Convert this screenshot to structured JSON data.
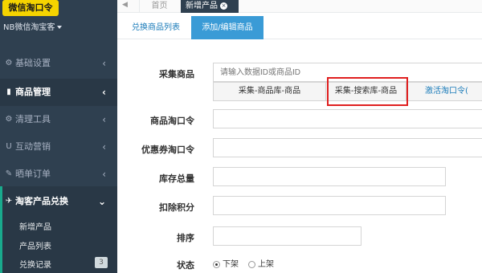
{
  "sidebar": {
    "logo_text": "微信淘口令",
    "account": "NB微信淘宝客",
    "nav": [
      {
        "icon": "⚙",
        "label": "基础设置",
        "arrow": "‹"
      },
      {
        "icon": "▮",
        "label": "商品管理",
        "arrow": "‹"
      },
      {
        "icon": "⚙",
        "label": "清理工具",
        "arrow": "‹"
      },
      {
        "icon": "U",
        "label": "互动营销",
        "arrow": "‹"
      },
      {
        "icon": "✎",
        "label": "晒单订单",
        "arrow": "‹"
      },
      {
        "icon": "✈",
        "label": "淘客产品兑换",
        "arrow": "⌄"
      }
    ],
    "sub_items": [
      {
        "label": "新增产品"
      },
      {
        "label": "产品列表"
      },
      {
        "label": "兑换记录",
        "badge": "3"
      }
    ]
  },
  "topbar": {
    "back_icon": "◀",
    "home": "首页",
    "active_tab": "新增产品",
    "close": "×"
  },
  "tabs": {
    "list": "兑换商品列表",
    "edit": "添加/编辑商品"
  },
  "form": {
    "collect_label": "采集商品",
    "collect_placeholder": "请输入数据ID或商品ID",
    "btn_goods_lib": "采集-商品库-商品",
    "btn_search_lib": "采集-搜索库-商品",
    "btn_activate": "激活淘口令(",
    "tkl_label": "商品淘口令",
    "coupon_label": "优惠券淘口令",
    "stock_label": "库存总量",
    "points_label": "扣除积分",
    "sort_label": "排序",
    "status_label": "状态",
    "status_off": "下架",
    "status_on": "上架"
  },
  "colors": {
    "sidebar_bg": "#2f4050",
    "accent_blue": "#3a9bd6",
    "highlight_red": "#e02020",
    "logo_yellow": "#f5d400"
  }
}
